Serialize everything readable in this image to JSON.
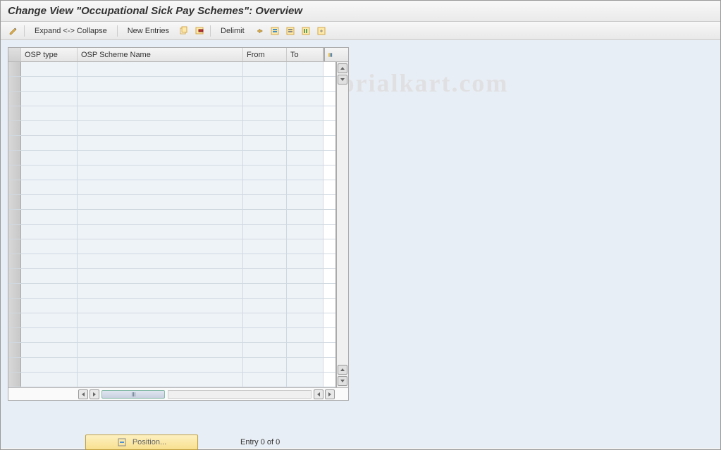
{
  "title": "Change View \"Occupational Sick Pay Schemes\": Overview",
  "toolbar": {
    "expand_collapse": "Expand <-> Collapse",
    "new_entries": "New Entries",
    "delimit": "Delimit"
  },
  "table": {
    "headers": {
      "osp_type": "OSP type",
      "osp_scheme_name": "OSP Scheme Name",
      "from": "From",
      "to": "To"
    },
    "row_count": 22
  },
  "footer": {
    "position_label": "Position...",
    "entry_text": "Entry 0 of 0"
  },
  "watermark": "© www.tutorialkart.com"
}
